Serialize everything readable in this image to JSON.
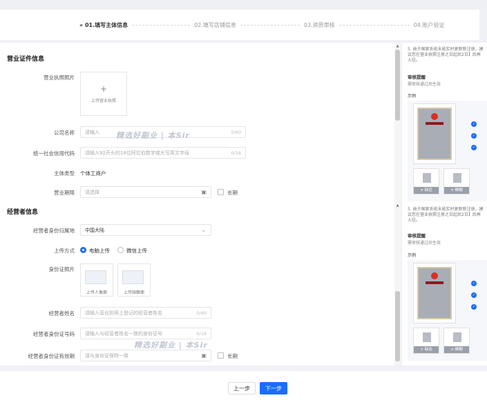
{
  "steps": [
    {
      "label": "» 01.填写主体信息"
    },
    {
      "label": "02.填写店铺信息"
    },
    {
      "label": "03.资质审核"
    },
    {
      "label": "04.账户验证"
    }
  ],
  "business_section": {
    "title": "营业证件信息",
    "license_photo_label": "营业执照照片",
    "upload_license_text": "上传营业执照",
    "company_name_label": "公司名称",
    "company_name_placeholder": "请输入",
    "company_name_count": "0/60",
    "credit_code_label": "统一社会信用代码",
    "credit_code_placeholder": "请输入92开头的18位阿拉伯数字或大写英文字母",
    "credit_code_count": "0/18",
    "subject_type_label": "主体类型",
    "subject_type_value": "个体工商户",
    "business_term_label": "营业期限",
    "business_term_placeholder": "请选择",
    "long_term_label": "长期"
  },
  "operator_section": {
    "title": "经营者信息",
    "region_label": "经营者身份归属地",
    "region_value": "中国大陆",
    "upload_method_label": "上传方式",
    "upload_options": [
      "电脑上传",
      "微信上传"
    ],
    "id_photo_label": "身份证照片",
    "id_front_text": "上传人像面",
    "id_back_text": "上传国徽面",
    "name_label": "经营者姓名",
    "name_placeholder": "请输入营业执照上登记的经营者姓名",
    "name_count": "0/40",
    "id_number_label": "经营者身份证号码",
    "id_number_placeholder": "请输入与经营者姓名一致的身份证号",
    "id_number_count": "0/18",
    "id_valid_label": "经营者身份证有效期",
    "id_valid_placeholder": "请与身份证保持一致",
    "long_term_label": "长期"
  },
  "watermark": "精选好副业 | 本Sir",
  "sidebar": {
    "note": "5. 由于国家系统未能实时更新新注册，建议您在营业执照注册之日起后2日】后再入驻。",
    "review_title": "审核提醒",
    "review_text": "需审核通过后生效",
    "sample_label": "示例",
    "thumb_labels": [
      "× 缺边",
      "× 模糊"
    ]
  },
  "footer": {
    "prev_label": "上一步",
    "next_label": "下一步"
  },
  "colors": {
    "accent": "#1a6dfb"
  }
}
